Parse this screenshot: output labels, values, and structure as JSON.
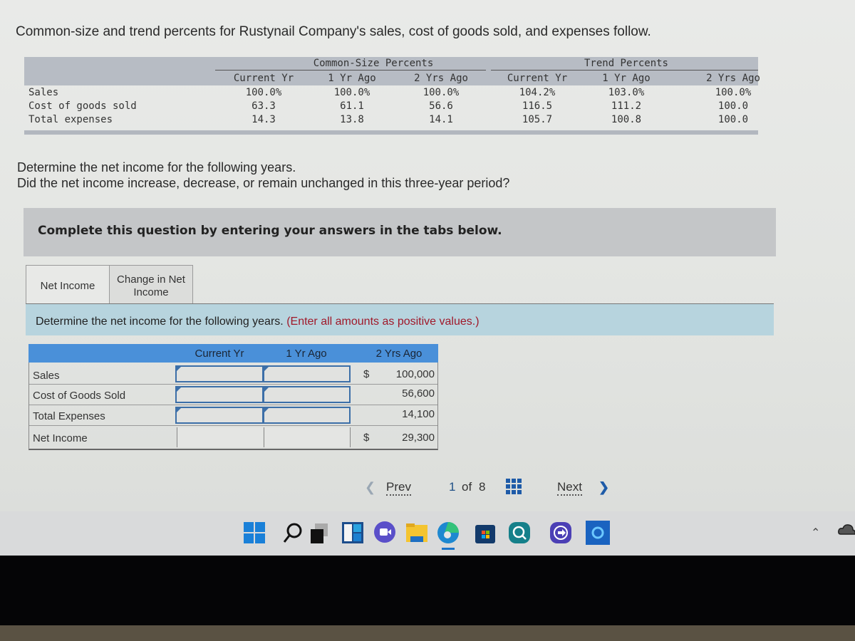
{
  "intro": "Common-size and trend percents for Rustynail Company's sales, cost of goods sold, and expenses follow.",
  "percent_table": {
    "common_size_title": "Common-Size Percents",
    "trend_title": "Trend Percents",
    "columns": [
      "Current Yr",
      "1 Yr Ago",
      "2 Yrs Ago",
      "Current Yr",
      "1 Yr Ago",
      "2 Yrs Ago"
    ],
    "rows": [
      {
        "label": "Sales",
        "values": [
          "100.0%",
          "100.0%",
          "100.0%",
          "104.2%",
          "103.0%",
          "100.0%"
        ]
      },
      {
        "label": "Cost of goods sold",
        "values": [
          "63.3",
          "61.1",
          "56.6",
          "116.5",
          "111.2",
          "100.0"
        ]
      },
      {
        "label": "Total expenses",
        "values": [
          "14.3",
          "13.8",
          "14.1",
          "105.7",
          "100.8",
          "100.0"
        ]
      }
    ]
  },
  "questions": {
    "q1": "Determine the net income for the following years.",
    "q2": "Did the net income increase, decrease, or remain unchanged in this three-year period?"
  },
  "banner": "Complete this question by entering your answers in the tabs below.",
  "tabs": [
    {
      "label": "Net Income",
      "active": true
    },
    {
      "label": "Change in Net Income",
      "active": false
    }
  ],
  "instruction": {
    "text": "Determine the net income for the following years.",
    "note": "(Enter all amounts as positive values.)"
  },
  "answer_table": {
    "columns": [
      "Current Yr",
      "1 Yr Ago",
      "2 Yrs Ago"
    ],
    "rows": [
      {
        "label": "Sales",
        "current": "",
        "one_yr": "",
        "currency": "$",
        "two_yrs": "100,000"
      },
      {
        "label": "Cost of Goods Sold",
        "current": "",
        "one_yr": "",
        "currency": "",
        "two_yrs": "56,600"
      },
      {
        "label": "Total Expenses",
        "current": "",
        "one_yr": "",
        "currency": "",
        "two_yrs": "14,100"
      },
      {
        "label": "Net Income",
        "current": "",
        "one_yr": "",
        "currency": "$",
        "two_yrs": "29,300"
      }
    ]
  },
  "pager": {
    "prev": "Prev",
    "current": "1",
    "of": "of",
    "total": "8",
    "next": "Next"
  },
  "taskbar": {
    "icons": [
      "windows-start",
      "search",
      "task-view",
      "widgets",
      "teams-chat",
      "file-explorer",
      "edge",
      "microsoft-store",
      "search-app",
      "app-connect",
      "cortana"
    ],
    "accent": "#1a73c9"
  }
}
